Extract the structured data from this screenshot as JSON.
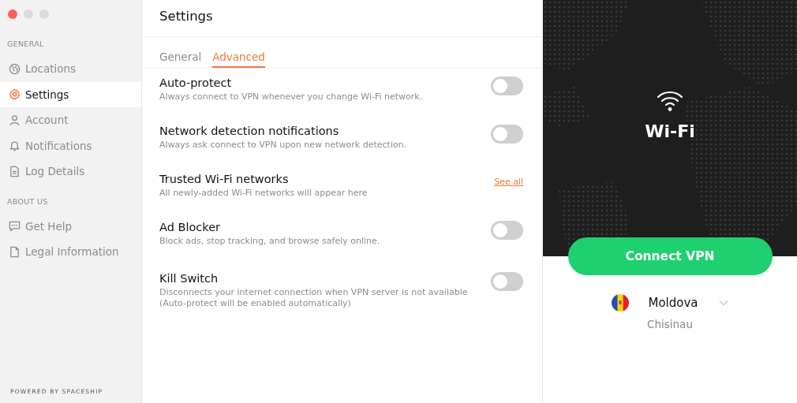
{
  "sidebar": {
    "sections": [
      {
        "heading": "GENERAL",
        "items": [
          {
            "kind": "globe",
            "label": "Locations",
            "selected": false
          },
          {
            "kind": "gear",
            "label": "Settings",
            "selected": true
          },
          {
            "kind": "person",
            "label": "Account",
            "selected": false
          },
          {
            "kind": "bell",
            "label": "Notifications",
            "selected": false
          },
          {
            "kind": "doc",
            "label": "Log Details",
            "selected": false
          }
        ]
      },
      {
        "heading": "ABOUT US",
        "items": [
          {
            "kind": "chat",
            "label": "Get Help",
            "selected": false
          },
          {
            "kind": "page",
            "label": "Legal Information",
            "selected": false
          }
        ]
      }
    ],
    "footer": "POWERED BY SPACESHIP"
  },
  "settings": {
    "title": "Settings",
    "tabs": [
      {
        "label": "General",
        "selected": false
      },
      {
        "label": "Advanced",
        "selected": true
      }
    ],
    "rows": [
      {
        "kind": "toggle",
        "title": "Auto-protect",
        "description": "Always connect to VPN whenever you change Wi-Fi network.",
        "on": false
      },
      {
        "kind": "toggle",
        "title": "Network detection notifications",
        "description": "Always ask connect to VPN upon new network detection.",
        "on": false
      },
      {
        "kind": "link",
        "title": "Trusted Wi-Fi networks",
        "description": "All newly-added Wi-Fi networks will appear here",
        "link": "See all"
      },
      {
        "kind": "toggle",
        "title": "Ad Blocker",
        "description": "Block ads, stop tracking, and browse safely online.",
        "on": false
      },
      {
        "kind": "toggle",
        "title": "Kill Switch",
        "description": "Disconnects your internet connection when VPN server is not available (Auto-protect will be enabled automatically)",
        "on": false
      }
    ]
  },
  "connection": {
    "network": "Wi-Fi",
    "button": "Connect VPN",
    "country": "Moldova",
    "city": "Chisinau"
  }
}
